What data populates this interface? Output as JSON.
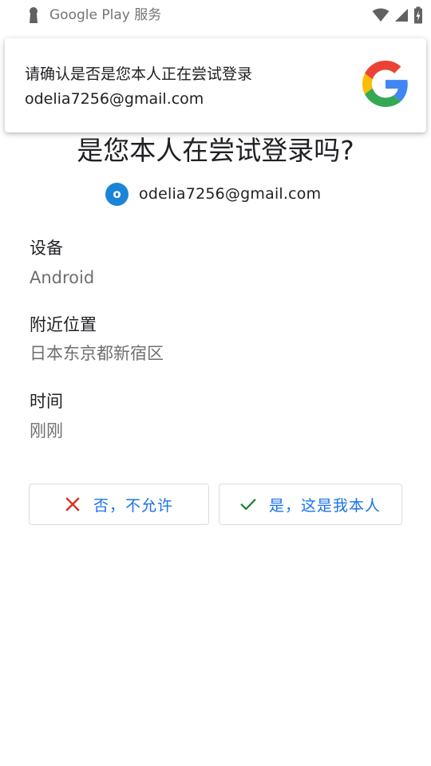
{
  "status_bar": {
    "app_name": "Google Play 服务"
  },
  "notification": {
    "title": "请确认是否是您本人正在尝试登录",
    "email": "odelia7256@gmail.com"
  },
  "main": {
    "title": "是您本人在尝试登录吗?",
    "avatar_letter": "o",
    "account_email": "odelia7256@gmail.com"
  },
  "details": {
    "device_label": "设备",
    "device_value": "Android",
    "location_label": "附近位置",
    "location_value": "日本东京都新宿区",
    "time_label": "时间",
    "time_value": "刚刚"
  },
  "buttons": {
    "deny_label": "否，不允许",
    "allow_label": "是，这是我本人"
  },
  "colors": {
    "link_blue": "#1a73e8",
    "avatar_blue": "#1a85d6",
    "deny_red": "#d93025",
    "allow_green": "#188038"
  }
}
